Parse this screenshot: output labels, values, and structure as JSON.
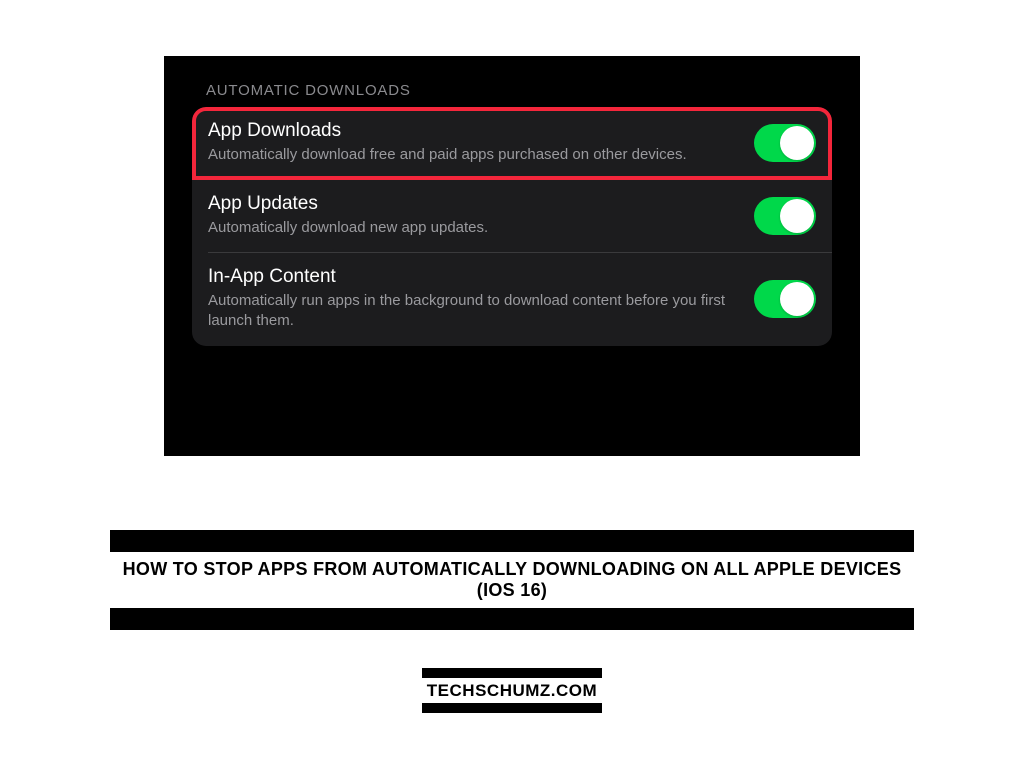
{
  "section_header": "AUTOMATIC DOWNLOADS",
  "rows": [
    {
      "title": "App Downloads",
      "desc": "Automatically download free and paid apps purchased on other devices.",
      "toggle_on": true,
      "highlighted": true
    },
    {
      "title": "App Updates",
      "desc": "Automatically download new app updates.",
      "toggle_on": true,
      "highlighted": false
    },
    {
      "title": "In-App Content",
      "desc": "Automatically run apps in the background to download content before you first launch them.",
      "toggle_on": true,
      "highlighted": false
    }
  ],
  "caption": "How To Stop Apps from Automatically Downloading on all Apple Devices (iOS 16)",
  "credit": "TECHSCHUMZ.COM",
  "colors": {
    "toggle_on": "#00d84a",
    "highlight_border": "#f4263b"
  }
}
